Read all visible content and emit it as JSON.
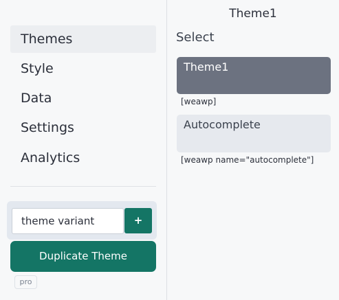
{
  "sidebar": {
    "items": [
      {
        "label": "Themes",
        "active": true
      },
      {
        "label": "Style",
        "active": false
      },
      {
        "label": "Data",
        "active": false
      },
      {
        "label": "Settings",
        "active": false
      },
      {
        "label": "Analytics",
        "active": false
      }
    ]
  },
  "variant": {
    "input_value": "theme variant",
    "add_label": "+",
    "duplicate_label": "Duplicate Theme",
    "badge": "pro"
  },
  "main": {
    "title": "Theme1",
    "select_label": "Select",
    "themes": [
      {
        "name": "Theme1",
        "shortcode": "[weawp]",
        "selected": true
      },
      {
        "name": "Autocomplete",
        "shortcode": "[weawp name=\"autocomplete\"]",
        "selected": false
      }
    ]
  },
  "colors": {
    "accent": "#147565",
    "selected_card": "#6c7280",
    "card": "#e6e9ee"
  }
}
